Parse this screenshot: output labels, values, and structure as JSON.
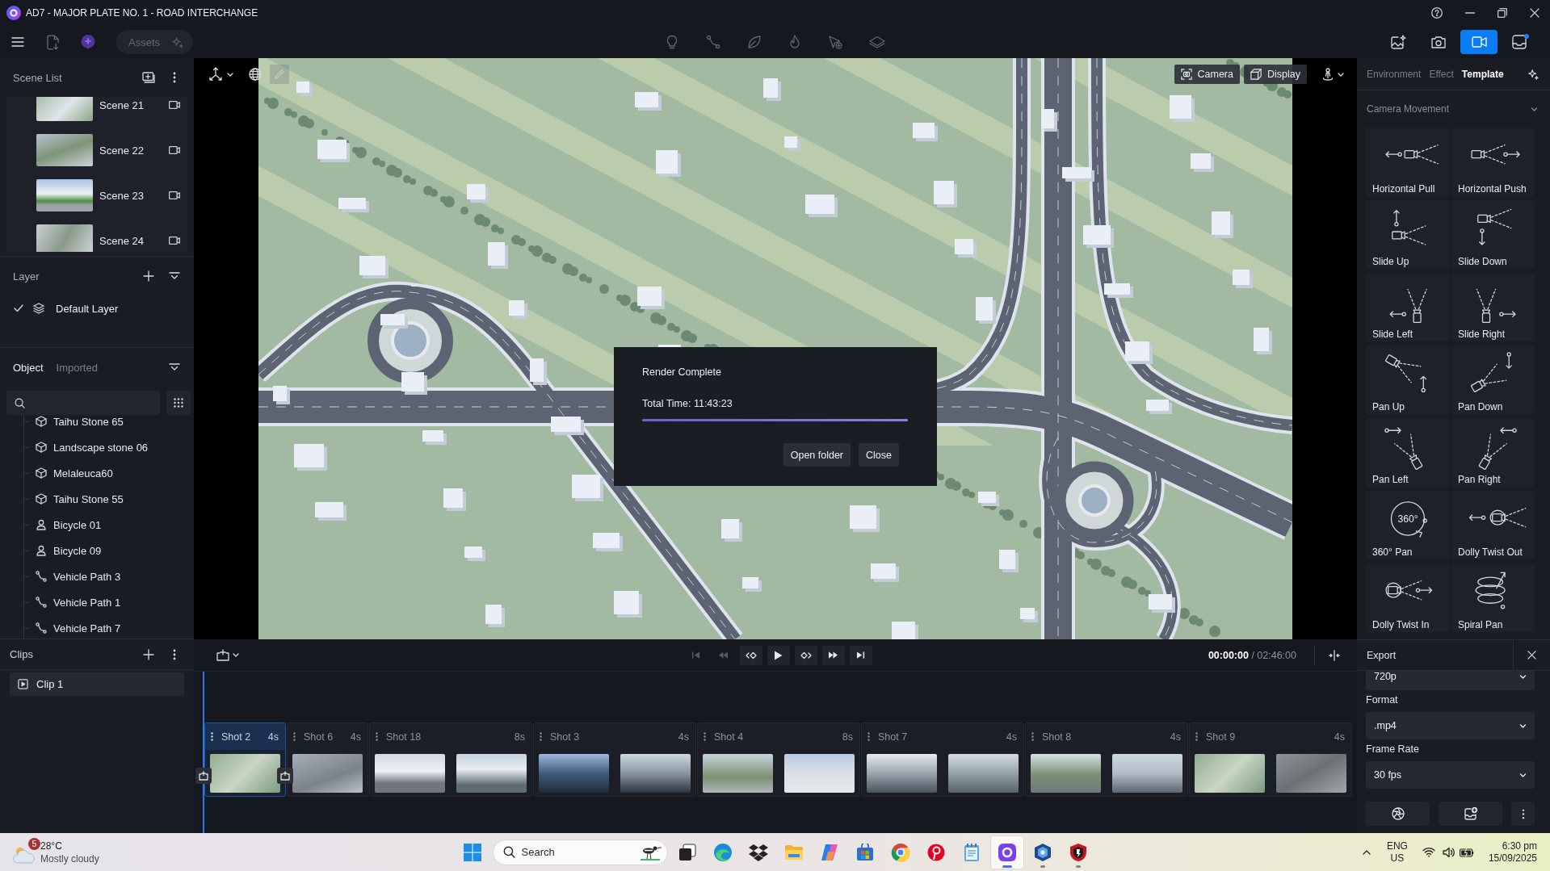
{
  "window": {
    "title": "AD7 - MAJOR PLATE NO. 1 - ROAD INTERCHANGE"
  },
  "toolbar": {
    "assets": "Assets",
    "modes": [
      {
        "kind": "image",
        "selected": false,
        "notification": false
      },
      {
        "kind": "camera",
        "selected": false,
        "notification": false
      },
      {
        "kind": "video",
        "selected": true,
        "notification": false
      },
      {
        "kind": "inbox",
        "selected": false,
        "notification": true
      }
    ]
  },
  "scene_list": {
    "title": "Scene List",
    "scenes": [
      {
        "name": "Scene 21"
      },
      {
        "name": "Scene 22"
      },
      {
        "name": "Scene 23"
      },
      {
        "name": "Scene 24"
      }
    ]
  },
  "layer_panel": {
    "title": "Layer",
    "layers": [
      {
        "name": "Default Layer",
        "checked": true
      }
    ]
  },
  "object_panel": {
    "tabs": [
      {
        "label": "Object",
        "selected": true
      },
      {
        "label": "Imported",
        "selected": false
      }
    ],
    "objects": [
      {
        "name": "Taihu Stone 65",
        "kind": "model"
      },
      {
        "name": "Landscape stone 06",
        "kind": "model"
      },
      {
        "name": "Melaleuca60",
        "kind": "model"
      },
      {
        "name": "Taihu Stone 55",
        "kind": "model"
      },
      {
        "name": "Bicycle 01",
        "kind": "person"
      },
      {
        "name": "Bicycle 09",
        "kind": "person"
      },
      {
        "name": "Vehicle Path 3",
        "kind": "path"
      },
      {
        "name": "Vehicle Path 1",
        "kind": "path"
      },
      {
        "name": "Vehicle Path 7",
        "kind": "path"
      }
    ]
  },
  "clips": {
    "title": "Clips",
    "items": [
      {
        "name": "Clip 1",
        "selected": true
      }
    ]
  },
  "viewport": {
    "buttons": [
      {
        "label": "Camera",
        "kind": "camera"
      },
      {
        "label": "Display",
        "kind": "display"
      }
    ],
    "eyedropper": {
      "disabled": true
    }
  },
  "render_dialog": {
    "title": "Render Complete",
    "total_time": "Total Time: 11:43:23",
    "progress": {
      "level": 1
    },
    "buttons": [
      "Open folder",
      "Close"
    ]
  },
  "timeline": {
    "transport": [
      {
        "kind": "skip-start",
        "disabled": true
      },
      {
        "kind": "rewind",
        "disabled": true
      },
      {
        "kind": "prev-key",
        "disabled": false
      },
      {
        "kind": "play",
        "disabled": false
      },
      {
        "kind": "next-key",
        "disabled": false
      },
      {
        "kind": "fast-forward",
        "disabled": false
      },
      {
        "kind": "skip-end",
        "disabled": false
      }
    ],
    "time": "**00:00:00** / 02:46:00",
    "shots": [
      {
        "label": "Shot 2",
        "duration": "4s",
        "selected": true,
        "kind": "single"
      },
      {
        "label": "Shot 6",
        "duration": "4s",
        "selected": false,
        "kind": "single"
      },
      {
        "label": "Shot 18",
        "duration": "8s",
        "selected": false,
        "kind": "double"
      },
      {
        "label": "Shot 3",
        "duration": "4s",
        "selected": false,
        "kind": "double"
      },
      {
        "label": "Shot 4",
        "duration": "8s",
        "selected": false,
        "kind": "double"
      },
      {
        "label": "Shot 7",
        "duration": "4s",
        "selected": false,
        "kind": "double"
      },
      {
        "label": "Shot 8",
        "duration": "4s",
        "selected": false,
        "kind": "double"
      },
      {
        "label": "Shot 9",
        "duration": "4s",
        "selected": false,
        "kind": "double"
      }
    ]
  },
  "template_panel": {
    "tabs": [
      {
        "label": "Environment",
        "selected": false
      },
      {
        "label": "Effect",
        "selected": false
      },
      {
        "label": "Template",
        "selected": true
      }
    ],
    "section": "Camera Movement",
    "templates": [
      {
        "label": "Horizontal Pull",
        "kind": "horizontal-pull"
      },
      {
        "label": "Horizontal Push",
        "kind": "horizontal-push"
      },
      {
        "label": "Slide Up",
        "kind": "slide-up"
      },
      {
        "label": "Slide Down",
        "kind": "slide-down"
      },
      {
        "label": "Slide Left",
        "kind": "slide-left"
      },
      {
        "label": "Slide Right",
        "kind": "slide-right"
      },
      {
        "label": "Pan Up",
        "kind": "pan-up"
      },
      {
        "label": "Pan Down",
        "kind": "pan-down"
      },
      {
        "label": "Pan Left",
        "kind": "pan-left"
      },
      {
        "label": "Pan Right",
        "kind": "pan-right"
      },
      {
        "label": "360° Pan",
        "kind": "orbit",
        "icon_text": "360°"
      },
      {
        "label": "Dolly Twist Out",
        "kind": "dolly-twist-out"
      },
      {
        "label": "Dolly Twist In",
        "kind": "dolly-twist-in"
      },
      {
        "label": "Spiral Pan",
        "kind": "spiral"
      }
    ]
  },
  "export_panel": {
    "title": "Export",
    "fields": [
      {
        "value": "720p"
      },
      {
        "label": "Format",
        "value": ".mp4"
      },
      {
        "label": "Frame Rate",
        "value": "30 fps"
      }
    ]
  },
  "taskbar": {
    "weather": {
      "badge": "5",
      "temperature": "28°C",
      "condition": "Mostly cloudy"
    },
    "search": {
      "placeholder": "Search"
    },
    "apps": [
      {
        "kind": "task-view",
        "selected": false,
        "running": false
      },
      {
        "kind": "edge",
        "selected": false,
        "running": false
      },
      {
        "kind": "dropbox",
        "selected": false,
        "running": false
      },
      {
        "kind": "explorer",
        "selected": false,
        "running": false
      },
      {
        "kind": "copilot",
        "selected": false,
        "running": false
      },
      {
        "kind": "store",
        "selected": false,
        "running": false
      },
      {
        "kind": "chrome",
        "selected": false,
        "running": false
      },
      {
        "kind": "pinterest",
        "selected": false,
        "running": false
      },
      {
        "kind": "notepad",
        "selected": false,
        "running": false
      },
      {
        "kind": "planner",
        "selected": true,
        "running": true
      },
      {
        "kind": "sketchup",
        "selected": false,
        "running": true
      },
      {
        "kind": "shield",
        "selected": false,
        "running": true
      }
    ],
    "tray": {
      "language": "ENG",
      "region": "US",
      "time": "6:30 pm",
      "date": "15/09/2025"
    }
  }
}
